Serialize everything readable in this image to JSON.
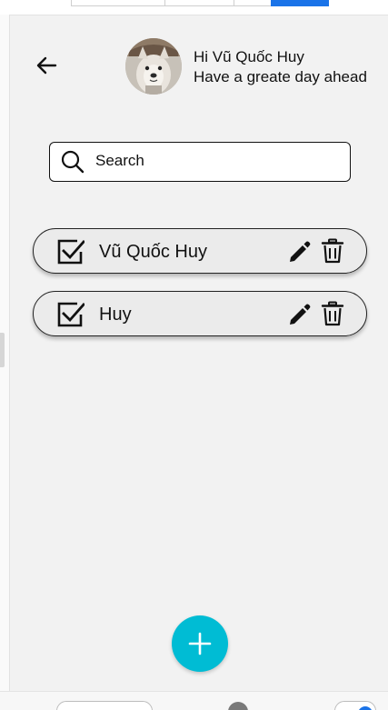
{
  "header": {
    "greeting_line1": "Hi Vũ Quốc Huy",
    "greeting_line2": "Have a greate day ahead"
  },
  "search": {
    "placeholder": "Search",
    "value": ""
  },
  "tasks": [
    {
      "label": "Vũ Quốc Huy",
      "checked": true
    },
    {
      "label": "Huy",
      "checked": true
    }
  ],
  "icons": {
    "back": "arrow-left-icon",
    "search": "search-icon",
    "check": "checkbox-checked-icon",
    "edit": "pencil-icon",
    "delete": "trash-icon",
    "add": "plus-icon"
  },
  "colors": {
    "fab": "#00bcd4",
    "screen_bg": "#f2f2f2",
    "task_bg": "#ebebeb"
  }
}
